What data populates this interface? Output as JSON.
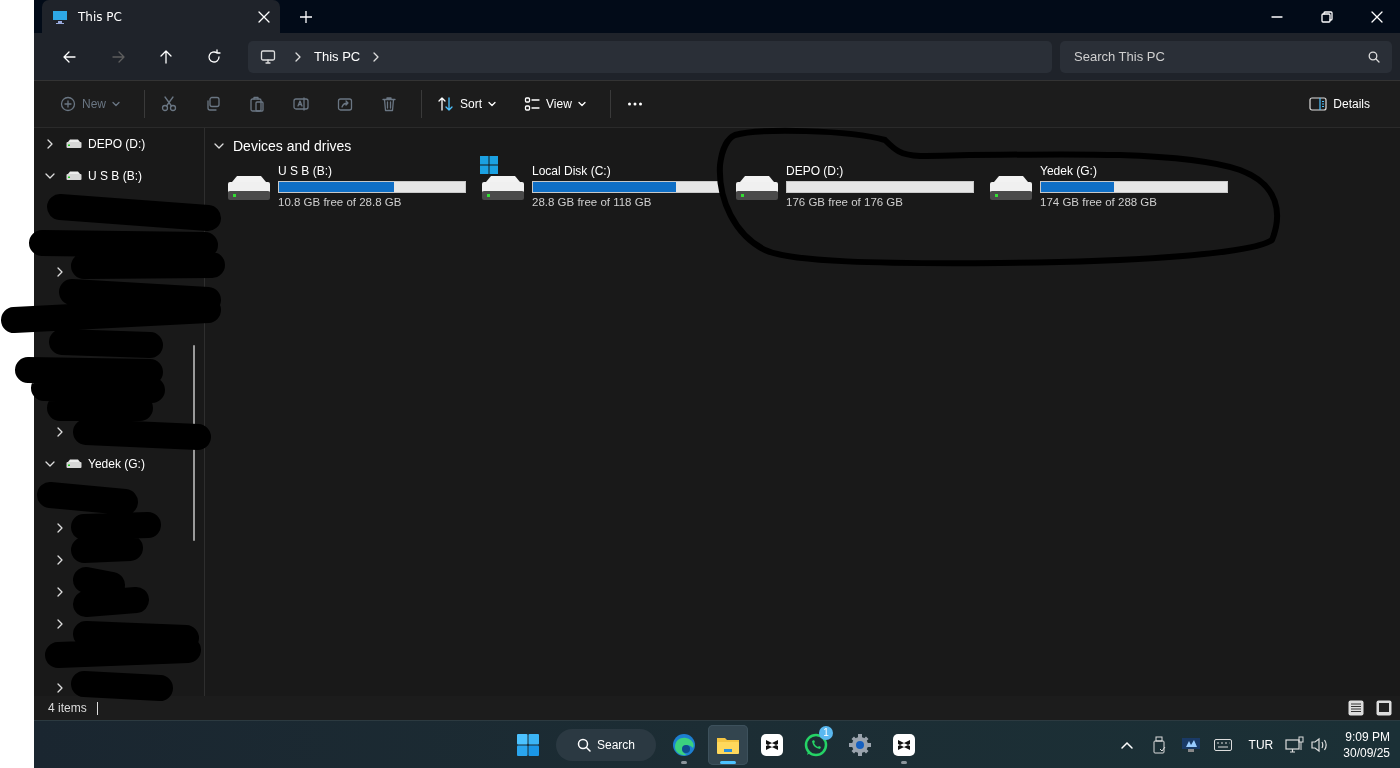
{
  "window": {
    "tab": {
      "title": "This PC",
      "selected": true
    }
  },
  "nav_buttons": [
    {
      "kind": "back",
      "disabled": false
    },
    {
      "kind": "forward",
      "disabled": true
    },
    {
      "kind": "up",
      "disabled": false
    },
    {
      "kind": "refresh",
      "disabled": false
    }
  ],
  "address": {
    "segments": [
      "This PC"
    ]
  },
  "search": {
    "placeholder": "Search This PC"
  },
  "commands": [
    {
      "kind": "new",
      "label": "New",
      "disabled": true
    },
    {
      "kind": "separator"
    },
    {
      "kind": "cut",
      "disabled": true
    },
    {
      "kind": "copy",
      "disabled": true
    },
    {
      "kind": "paste",
      "disabled": true
    },
    {
      "kind": "rename",
      "disabled": true
    },
    {
      "kind": "share",
      "disabled": true
    },
    {
      "kind": "delete",
      "disabled": true
    },
    {
      "kind": "separator"
    },
    {
      "kind": "sort",
      "label": "Sort",
      "disabled": false
    },
    {
      "kind": "view",
      "label": "View",
      "disabled": false
    },
    {
      "kind": "separator"
    },
    {
      "kind": "more",
      "disabled": false
    }
  ],
  "details_button": {
    "label": "Details"
  },
  "sidebar": {
    "items": [
      {
        "kind": "drive",
        "label": "DEPO (D:)",
        "expanded": false
      },
      {
        "kind": "drive",
        "label": "U S B (B:)",
        "expanded": true,
        "children": [
          {
            "kind": "hidden",
            "expandable": false
          },
          {
            "kind": "hidden",
            "expandable": false
          },
          {
            "kind": "hidden",
            "expandable": true
          },
          {
            "kind": "hidden",
            "expandable": false
          },
          {
            "kind": "hidden",
            "expandable": false
          },
          {
            "kind": "hidden",
            "expandable": false
          },
          {
            "kind": "hidden",
            "expandable": false
          },
          {
            "kind": "hidden",
            "expandable": true
          }
        ]
      },
      {
        "kind": "drive",
        "label": "Yedek (G:)",
        "expanded": true,
        "children": [
          {
            "kind": "hidden",
            "expandable": false
          },
          {
            "kind": "hidden",
            "expandable": true
          },
          {
            "kind": "hidden",
            "expandable": true
          },
          {
            "kind": "hidden",
            "expandable": true
          },
          {
            "kind": "hidden",
            "expandable": true
          },
          {
            "kind": "hidden",
            "expandable": false
          },
          {
            "kind": "hidden",
            "expandable": true
          }
        ]
      }
    ]
  },
  "section": {
    "title": "Devices and drives",
    "expanded": true,
    "drives": [
      {
        "name": "U S B (B:)",
        "level": 0.62,
        "free": "10.8 GB free of 28.8 GB",
        "system": false
      },
      {
        "name": "Local Disk (C:)",
        "level": 0.77,
        "free": "28.8 GB free of 118 GB",
        "system": true
      },
      {
        "name": "DEPO (D:)",
        "level": 0,
        "free": "176 GB free of 176 GB",
        "system": false
      },
      {
        "name": "Yedek (G:)",
        "level": 0.39,
        "free": "174 GB free of 288 GB",
        "system": false
      }
    ]
  },
  "status_bar": {
    "item_count": "4 items"
  },
  "taskbar": {
    "apps": [
      {
        "kind": "start",
        "running": false,
        "selected": false
      },
      {
        "kind": "search",
        "label": "Search"
      },
      {
        "kind": "edge",
        "running": true,
        "selected": false
      },
      {
        "kind": "explorer",
        "running": true,
        "selected": true
      },
      {
        "kind": "capcut",
        "running": false,
        "selected": false
      },
      {
        "kind": "whatsapp",
        "running": false,
        "selected": false,
        "badge": "1"
      },
      {
        "kind": "settings",
        "running": false,
        "selected": false
      },
      {
        "kind": "capcut",
        "running": true,
        "selected": false
      }
    ],
    "tray": {
      "language": "TUR",
      "time": "9:09 PM",
      "date": "30/09/25"
    }
  }
}
